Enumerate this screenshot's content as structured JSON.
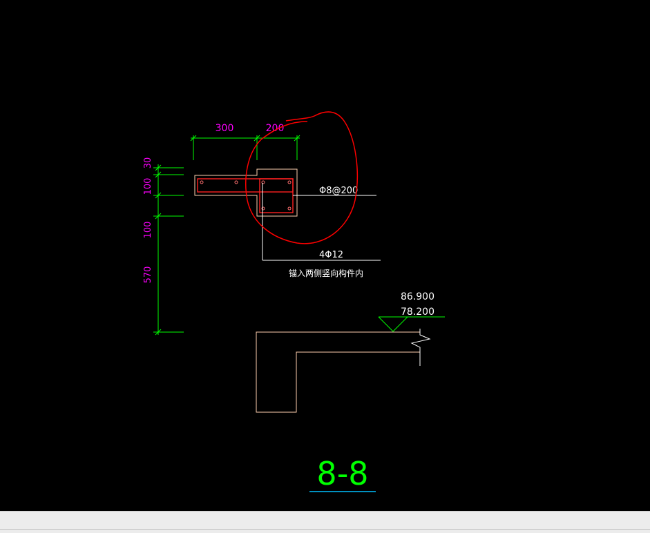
{
  "drawing": {
    "dims_top": [
      "300",
      "200"
    ],
    "dims_left": [
      "30",
      "100",
      "100",
      "570"
    ],
    "rebar_stirrup": "Φ8@200",
    "rebar_main": "4Φ12",
    "anchor_note": "锚入两侧竖向构件内",
    "elevation_top": "86.900",
    "elevation_bottom": "78.200",
    "section_title": "8-8"
  },
  "colors": {
    "background": "#000000",
    "dimension": "#00ff00",
    "dim_text": "#ff00ff",
    "concrete": "#ffd0b0",
    "rebar": "#ff2020",
    "text": "#ffffff",
    "annotation": "#ff0000",
    "title_underline": "#00c0ff"
  }
}
